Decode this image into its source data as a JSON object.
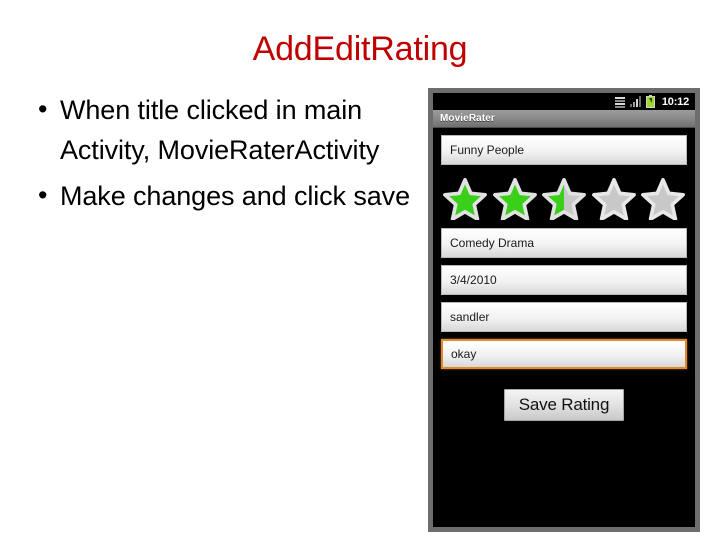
{
  "slide": {
    "title": "AddEditRating",
    "title_color": "#C00000",
    "bullets": [
      {
        "bullet_glyph": "•",
        "text": "When title clicked in main Activity, MovieRaterActivity"
      },
      {
        "bullet_glyph": "•",
        "text": "Make changes and click save"
      }
    ]
  },
  "phone": {
    "status_bar": {
      "time": "10:12",
      "icons": [
        "sync-data-icon",
        "signal-bars-icon",
        "battery-charging-icon"
      ]
    },
    "app_title": "MovieRater",
    "fields": [
      {
        "name": "movie-title-field",
        "value": "Funny People",
        "focused": false
      },
      {
        "name": "genre-field",
        "value": "Comedy Drama",
        "focused": false
      },
      {
        "name": "date-field",
        "value": "3/4/2010",
        "focused": false
      },
      {
        "name": "actor-field",
        "value": "sandler",
        "focused": false
      },
      {
        "name": "comment-field",
        "value": "okay",
        "focused": true
      }
    ],
    "rating": {
      "value": 2.5,
      "max": 5,
      "filled_color": "#3ad01a",
      "empty_color": "#c8c8c8"
    },
    "save_button_label": "Save Rating",
    "focus_color": "#E08A2B"
  }
}
